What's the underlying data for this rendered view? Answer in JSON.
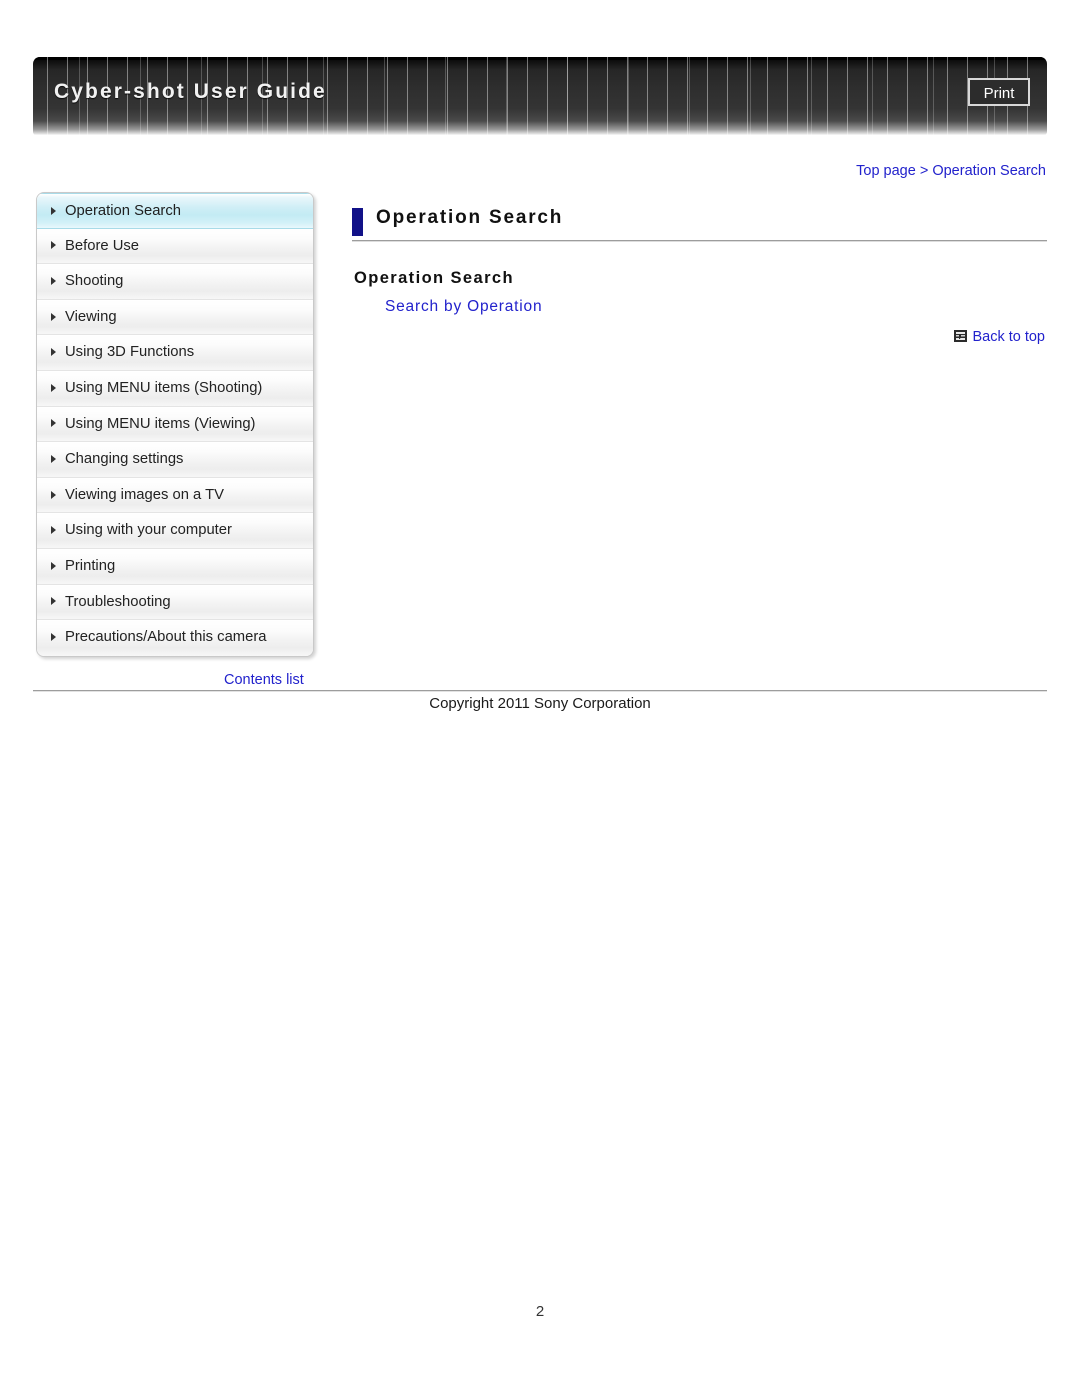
{
  "header": {
    "title": "Cyber-shot User Guide",
    "print_label": "Print"
  },
  "breadcrumb": {
    "top_page": "Top page",
    "separator": ">",
    "current": "Operation Search",
    "full": "Top page > Operation Search"
  },
  "sidebar": {
    "items": [
      {
        "label": "Operation Search",
        "active": true
      },
      {
        "label": "Before Use",
        "active": false
      },
      {
        "label": "Shooting",
        "active": false
      },
      {
        "label": "Viewing",
        "active": false
      },
      {
        "label": "Using 3D Functions",
        "active": false
      },
      {
        "label": "Using MENU items (Shooting)",
        "active": false
      },
      {
        "label": "Using MENU items (Viewing)",
        "active": false
      },
      {
        "label": "Changing settings",
        "active": false
      },
      {
        "label": "Viewing images on a TV",
        "active": false
      },
      {
        "label": "Using with your computer",
        "active": false
      },
      {
        "label": "Printing",
        "active": false
      },
      {
        "label": "Troubleshooting",
        "active": false
      },
      {
        "label": "Precautions/About this camera",
        "active": false
      }
    ],
    "contents_list_label": "Contents list"
  },
  "main": {
    "page_title": "Operation Search",
    "section_heading": "Operation Search",
    "sub_link": "Search by Operation",
    "back_to_top": "Back to top",
    "back_to_top_icon": "back-to-top-icon"
  },
  "footer": {
    "copyright": "Copyright 2011 Sony Corporation"
  },
  "page_number": "2",
  "colors": {
    "link": "#2222CC",
    "title_marker": "#111188",
    "active_nav": "#C3EBF4",
    "header_dark": "#2E2E2E"
  }
}
